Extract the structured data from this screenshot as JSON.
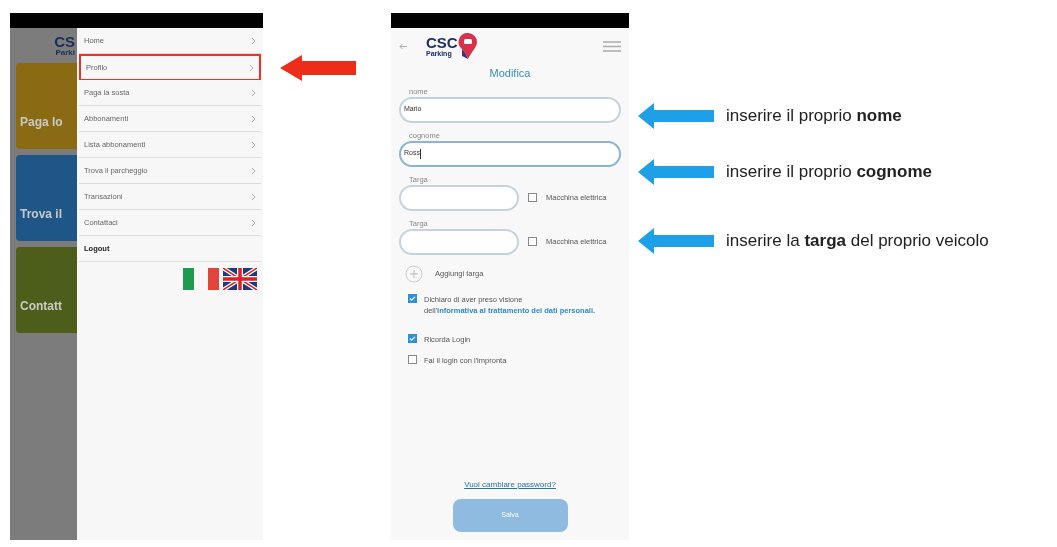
{
  "menu_screen": {
    "logo": "CS",
    "logo_sub": "Parki",
    "cards": [
      {
        "title": "Paga lo",
        "color": "#8a6a12"
      },
      {
        "title": "Trova il",
        "color": "#1f5688"
      },
      {
        "title": "Contatt",
        "color": "#4d5e1a"
      }
    ],
    "menu": [
      {
        "label": "Home",
        "kind": "link",
        "selected": false
      },
      {
        "label": "Profilo",
        "kind": "link",
        "selected": true
      },
      {
        "label": "Paga la sosta",
        "kind": "link",
        "selected": false
      },
      {
        "label": "Abbonamenti",
        "kind": "link",
        "selected": false
      },
      {
        "label": "Lista abbonamenti",
        "kind": "link",
        "selected": false
      },
      {
        "label": "Trova il parcheggio",
        "kind": "link",
        "selected": false
      },
      {
        "label": "Transazioni",
        "kind": "link",
        "selected": false
      },
      {
        "label": "Contattaci",
        "kind": "link",
        "selected": false
      },
      {
        "label": "Logout",
        "kind": "action",
        "selected": false
      }
    ]
  },
  "profile_screen": {
    "logo": "CSC",
    "logo_sub": "Parking",
    "title": "Modifica",
    "fields": [
      {
        "label": "nome",
        "value": "Mario",
        "focused": false
      },
      {
        "label": "cognome",
        "value": "Ross",
        "focused": true
      }
    ],
    "plates": [
      {
        "label": "Targa",
        "electric": {
          "label": "Macchina elettrica",
          "checked": false
        }
      },
      {
        "label": "Targa",
        "electric": {
          "label": "Macchina elettrica",
          "checked": false
        }
      }
    ],
    "add_plate": "Aggiungi targa",
    "checkboxes": [
      {
        "text": "Dichiaro di aver preso visione dell'",
        "link": "informativa al trattamento dei dati personali.",
        "checked": true
      },
      {
        "text": "Ricorda Login",
        "checked": true
      },
      {
        "text": "Fai il login con l'impronta",
        "checked": false
      }
    ],
    "password_link": "Vuoi cambiare password?",
    "save_button": "Salva"
  },
  "callouts": [
    {
      "text": "inserire il proprio **nome**"
    },
    {
      "text": "inserire il proprio **cognome**"
    },
    {
      "text": "inserire la **targa** del proprio veicolo"
    }
  ]
}
